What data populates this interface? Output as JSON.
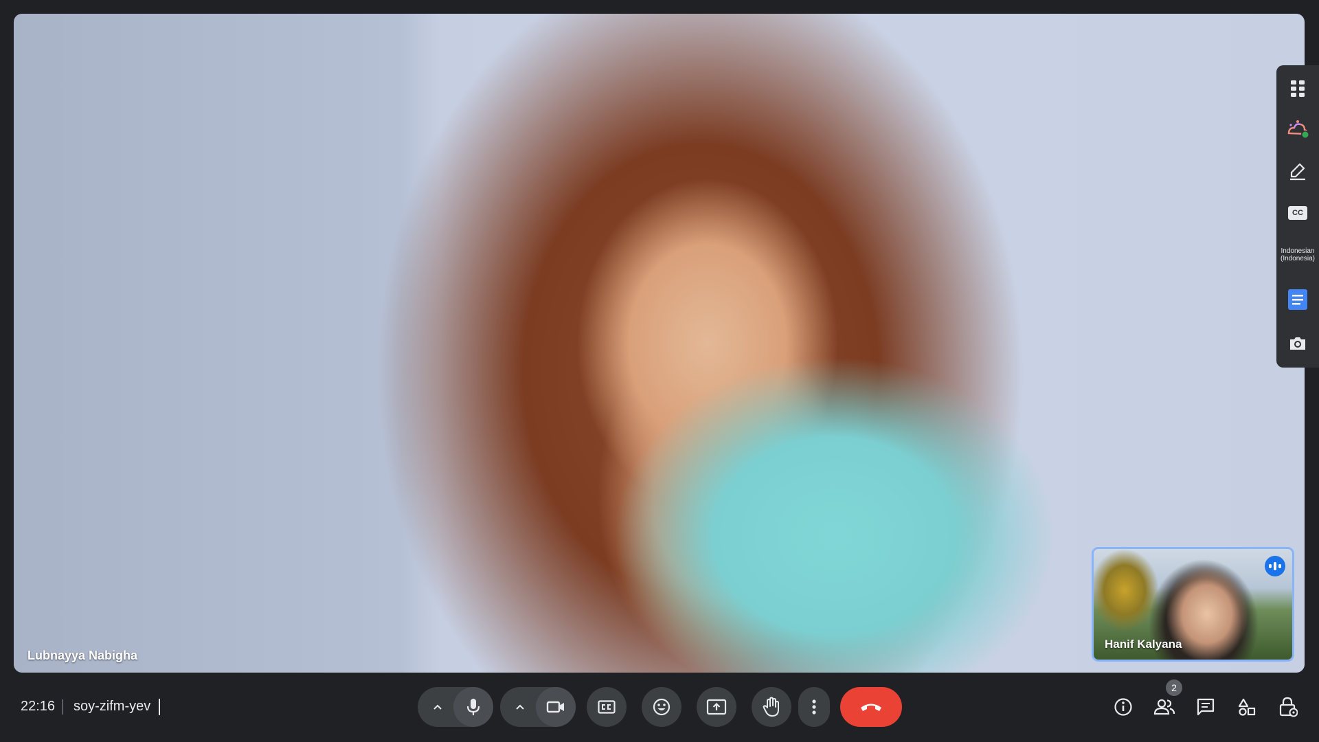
{
  "main_video": {
    "participant_name": "Lubnayya Nabigha"
  },
  "self_view": {
    "participant_name": "Hanif Kalyana"
  },
  "side_panel": {
    "items": [
      {
        "icon": "apps-grid-icon"
      },
      {
        "icon": "visual-effects-icon"
      },
      {
        "icon": "whiteboard-pen-icon"
      },
      {
        "icon": "closed-captions-icon",
        "label": "CC"
      },
      {
        "icon": "language-label",
        "label_line1": "Indonesian",
        "label_line2": "(Indonesia)"
      },
      {
        "icon": "notes-doc-icon"
      },
      {
        "icon": "camera-icon"
      }
    ]
  },
  "bottom_bar": {
    "time": "22:16",
    "meeting_code": "soy-zifm-yev",
    "controls": [
      {
        "icon": "microphone-icon"
      },
      {
        "icon": "video-camera-icon"
      },
      {
        "icon": "captions-icon"
      },
      {
        "icon": "emoji-icon"
      },
      {
        "icon": "present-screen-icon"
      },
      {
        "icon": "raise-hand-icon"
      },
      {
        "icon": "more-options-icon"
      },
      {
        "icon": "end-call-icon"
      }
    ],
    "right": [
      {
        "icon": "info-icon"
      },
      {
        "icon": "people-icon",
        "badge": "2"
      },
      {
        "icon": "chat-icon"
      },
      {
        "icon": "activities-icon"
      },
      {
        "icon": "host-controls-icon"
      }
    ]
  },
  "colors": {
    "end_call": "#ea4335",
    "speaking": "#1a73e8",
    "bar": "#202124"
  }
}
